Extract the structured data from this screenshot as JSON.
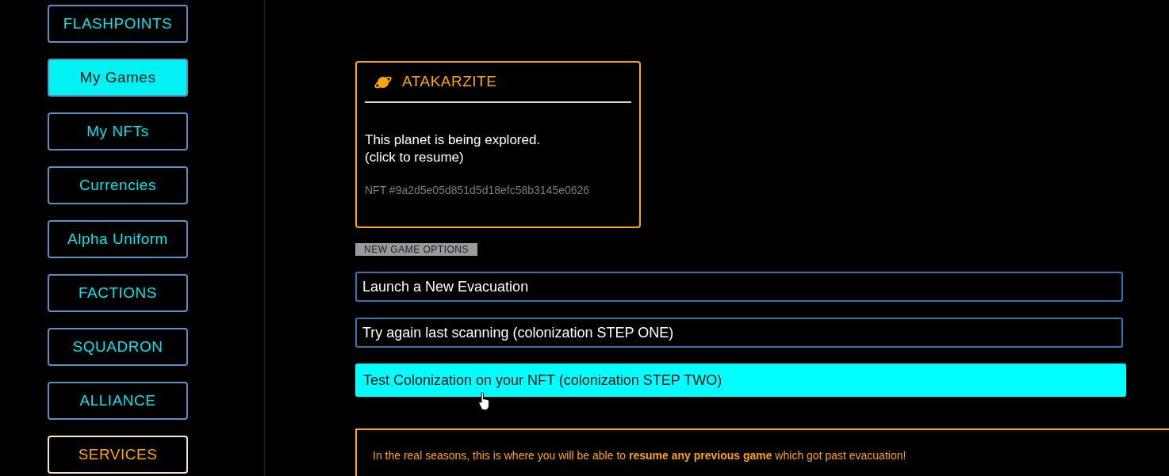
{
  "sidebar": {
    "items": [
      {
        "label": "FLASHPOINTS",
        "selected": false,
        "kind": "nav"
      },
      {
        "label": "My Games",
        "selected": true,
        "kind": "nav"
      },
      {
        "label": "My NFTs",
        "selected": false,
        "kind": "nav"
      },
      {
        "label": "Currencies",
        "selected": false,
        "kind": "nav"
      },
      {
        "label": "Alpha Uniform",
        "selected": false,
        "kind": "nav"
      },
      {
        "label": "FACTIONS",
        "selected": false,
        "kind": "nav"
      },
      {
        "label": "SQUADRON",
        "selected": false,
        "kind": "nav"
      },
      {
        "label": "ALLIANCE",
        "selected": false,
        "kind": "nav"
      },
      {
        "label": "SERVICES",
        "selected": false,
        "kind": "accent"
      }
    ]
  },
  "planet_card": {
    "title": "ATAKARZITE",
    "status": "This planet is being explored.",
    "action_hint": "(click to resume)",
    "nft_id": "NFT #9a2d5e05d851d5d18efc58b3145e0626"
  },
  "section_label": "NEW GAME OPTIONS",
  "options": [
    {
      "label": "Launch a New Evacuation",
      "hovered": false
    },
    {
      "label": "Try again last scanning (colonization STEP ONE)",
      "hovered": false
    },
    {
      "label": "Test Colonization on your NFT (colonization STEP TWO)",
      "hovered": true
    }
  ],
  "notice": "In the real seasons, this is where you will be able to **resume any previous game** which got past evacuation!"
}
